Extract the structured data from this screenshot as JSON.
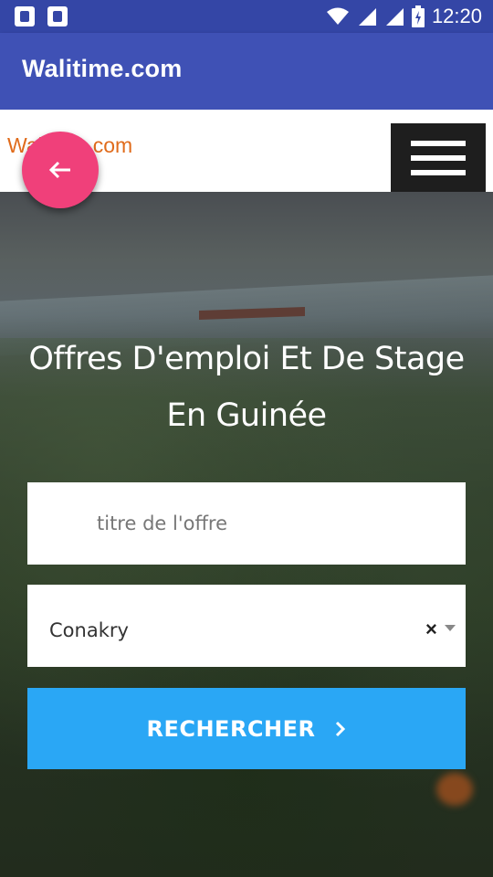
{
  "status_bar": {
    "time": "12:20",
    "icons": [
      "notification-icon",
      "notification-icon",
      "wifi-icon",
      "signal-icon",
      "signal-icon",
      "battery-charging-icon"
    ]
  },
  "app_bar": {
    "title": "Walitime.com"
  },
  "web_header": {
    "logo_text": "Walitime.com"
  },
  "hero": {
    "heading_line1": "Offres D'emploi Et De Stage",
    "heading_line2": "En Guinée"
  },
  "search": {
    "job_title_placeholder": "titre de l'offre",
    "city_value": "Conakry",
    "clear_symbol": "×",
    "button_label": "RECHERCHER"
  },
  "colors": {
    "app_bar": "#3f51b5",
    "status_bar": "#3446a6",
    "fab": "#f0407a",
    "button": "#2aa7f5",
    "logo": "#e06b1b"
  }
}
